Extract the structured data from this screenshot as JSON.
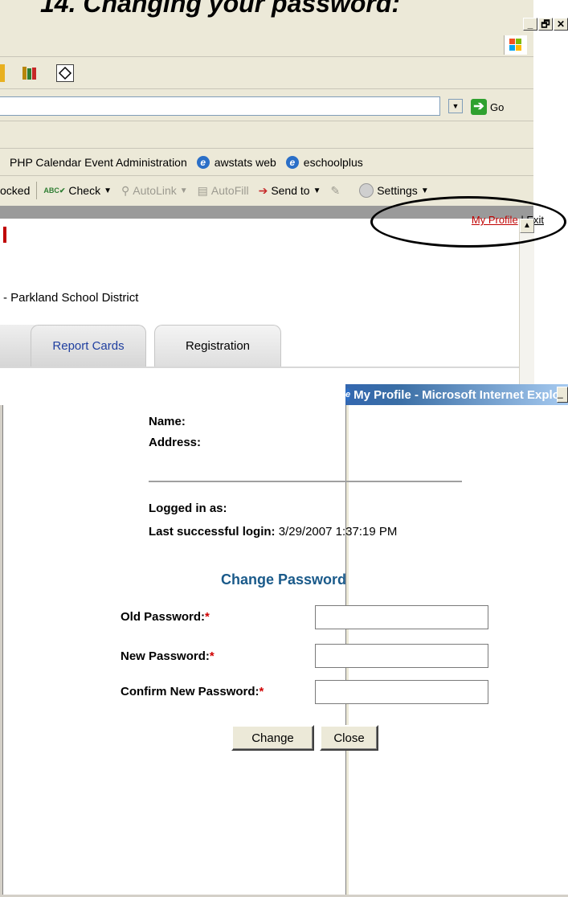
{
  "doc_heading": "14. Changing your password:",
  "back_window": {
    "controls": [
      "_",
      "🗗",
      "✕"
    ],
    "address_go": "Go",
    "links": [
      "PHP Calendar Event Administration",
      "awstats web",
      "eschoolplus"
    ],
    "google_toolbar": {
      "blocked": "ocked",
      "check": "Check",
      "autolink": "AutoLink",
      "autofill": "AutoFill",
      "send_to": "Send to",
      "settings": "Settings"
    },
    "topnav": {
      "my_profile": "My Profile",
      "separator": "|",
      "exit": "Exit"
    },
    "district": "- Parkland School District",
    "tabs": [
      "Report Cards",
      "Registration"
    ]
  },
  "popup": {
    "title": "My Profile - Microsoft Internet Explorer",
    "name_label": "Name:",
    "address_label": "Address:",
    "logged_in_label": "Logged in as:",
    "last_login_label": "Last successful login:",
    "last_login_value": "3/29/2007 1:37:19 PM",
    "change_password_title": "Change Password",
    "old_password_label": "Old Password:",
    "new_password_label": "New Password:",
    "confirm_password_label": "Confirm New Password:",
    "required_marker": "*",
    "old_password_value": "",
    "new_password_value": "",
    "confirm_password_value": "",
    "change_button": "Change",
    "close_button": "Close"
  }
}
